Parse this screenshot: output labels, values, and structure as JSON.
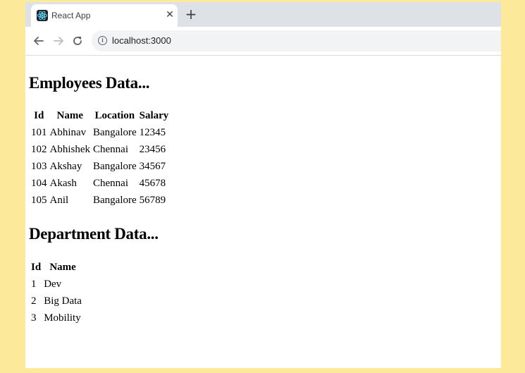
{
  "browser": {
    "tab": {
      "title": "React App",
      "favicon_icon": "react-atom-icon"
    },
    "address_bar": {
      "url": "localhost:3000"
    }
  },
  "employees": {
    "heading": "Employees Data...",
    "columns": [
      "Id",
      "Name",
      "Location",
      "Salary"
    ],
    "rows": [
      [
        "101",
        "Abhinav",
        "Bangalore",
        "12345"
      ],
      [
        "102",
        "Abhishek",
        "Chennai",
        "23456"
      ],
      [
        "103",
        "Akshay",
        "Bangalore",
        "34567"
      ],
      [
        "104",
        "Akash",
        "Chennai",
        "45678"
      ],
      [
        "105",
        "Anil",
        "Bangalore",
        "56789"
      ]
    ]
  },
  "departments": {
    "heading": "Department Data...",
    "columns": [
      "Id",
      "Name"
    ],
    "rows": [
      [
        "1",
        "Dev"
      ],
      [
        "2",
        "Big Data"
      ],
      [
        "3",
        "Mobility"
      ]
    ]
  },
  "colors": {
    "page_background": "#fde99a",
    "tabstrip": "#dee1e6",
    "react_blue": "#61dafb"
  }
}
